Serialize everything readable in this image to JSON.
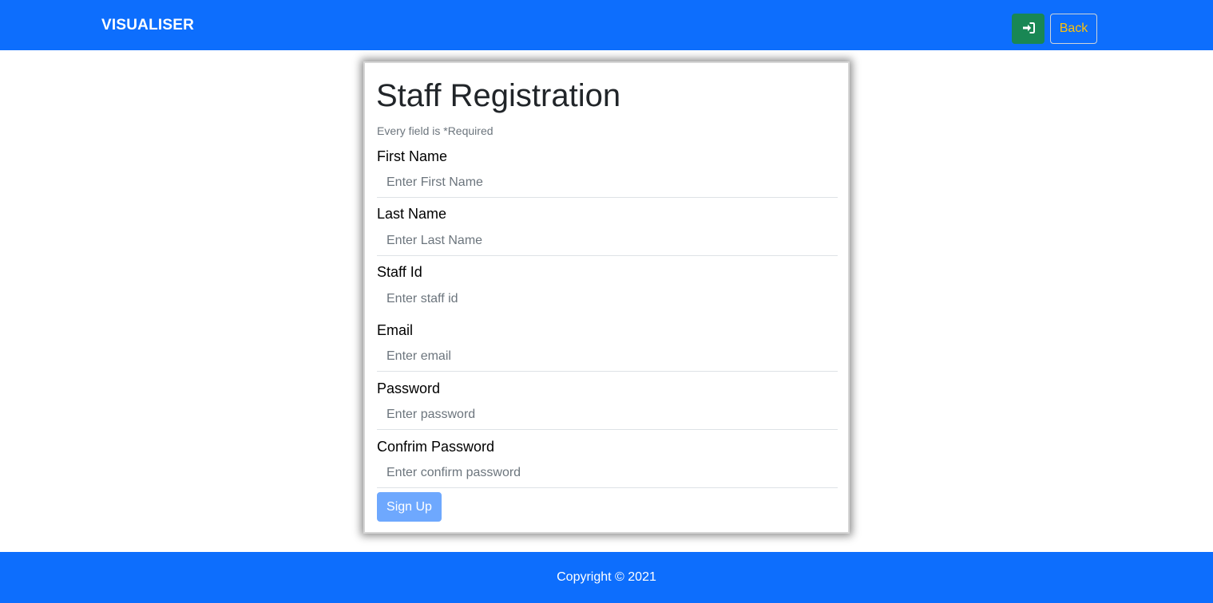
{
  "navbar": {
    "brand": "VISUALISER",
    "login_icon": "sign-in-icon",
    "back_label": "Back"
  },
  "form": {
    "title": "Staff Registration",
    "required_note": "Every field is *Required",
    "fields": [
      {
        "label": "First Name",
        "placeholder": "Enter First Name"
      },
      {
        "label": "Last Name",
        "placeholder": "Enter Last Name"
      },
      {
        "label": "Staff Id",
        "placeholder": "Enter staff id"
      },
      {
        "label": "Email",
        "placeholder": "Enter email"
      },
      {
        "label": "Password",
        "placeholder": "Enter password"
      },
      {
        "label": "Confrim Password",
        "placeholder": "Enter confirm password"
      }
    ],
    "submit_label": "Sign Up"
  },
  "footer": {
    "copyright": "Copyright © 2021"
  },
  "colors": {
    "primary": "#0d6efd",
    "success": "#198754",
    "warning": "#ffc107",
    "submit_disabled": "#6ea8fe"
  }
}
